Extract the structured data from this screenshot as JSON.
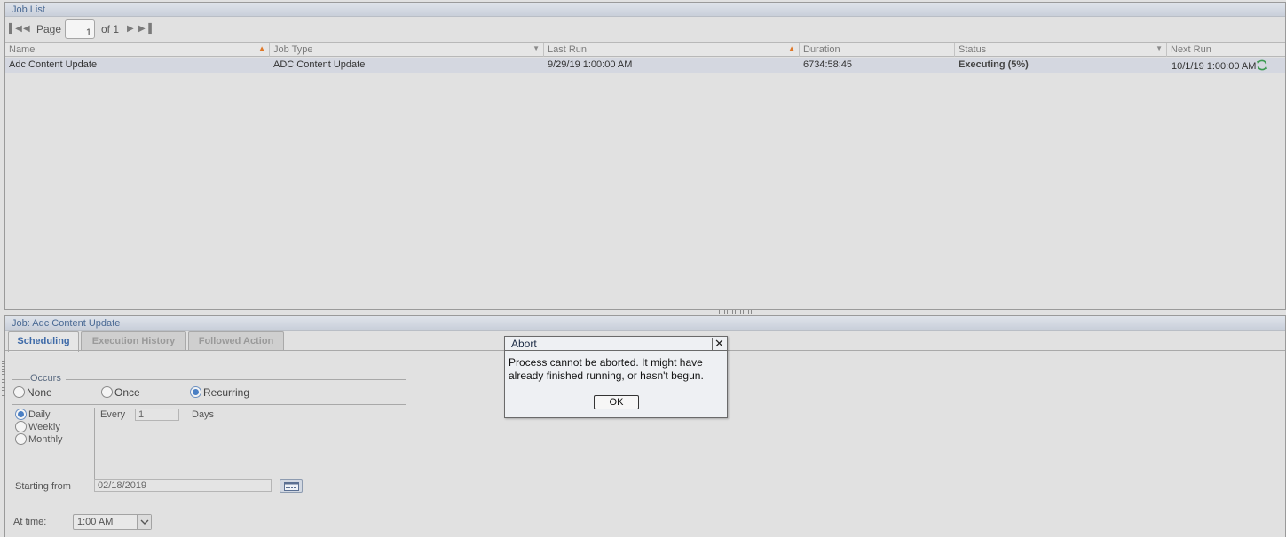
{
  "job_list": {
    "title": "Job List",
    "pager": {
      "page_label": "Page",
      "page_value": "1",
      "of_label": "of 1"
    },
    "columns": [
      {
        "label": "Name"
      },
      {
        "label": "Job Type"
      },
      {
        "label": "Last Run"
      },
      {
        "label": "Duration"
      },
      {
        "label": "Status"
      },
      {
        "label": "Next Run"
      }
    ],
    "rows": [
      {
        "name": "Adc Content Update",
        "job_type": "ADC Content Update",
        "last_run": "9/29/19 1:00:00 AM",
        "duration": "6734:58:45",
        "status": "Executing (5%)",
        "next_run": "10/1/19 1:00:00 AM"
      }
    ]
  },
  "job_panel": {
    "title": "Job: Adc Content Update",
    "tabs": [
      {
        "label": "Scheduling"
      },
      {
        "label": "Execution History"
      },
      {
        "label": "Followed Action"
      }
    ],
    "occurs": {
      "legend": "Occurs",
      "options": [
        "None",
        "Once",
        "Recurring"
      ],
      "selected": "Recurring"
    },
    "recurrence": {
      "options": [
        "Daily",
        "Weekly",
        "Monthly"
      ],
      "selected": "Daily",
      "every_label": "Every",
      "every_value": "1",
      "unit_label": "Days"
    },
    "starting_from": {
      "label": "Starting from",
      "value": "02/18/2019"
    },
    "at_time": {
      "label": "At time:",
      "value": "1:00 AM"
    }
  },
  "dialog": {
    "title": "Abort",
    "message": "Process cannot be aborted. It might have already finished running, or hasn't begun.",
    "ok_label": "OK"
  },
  "colors": {
    "accent_blue": "#3e6aa8",
    "sort_orange": "#e07828",
    "selected_row": "#d4d7e0"
  }
}
